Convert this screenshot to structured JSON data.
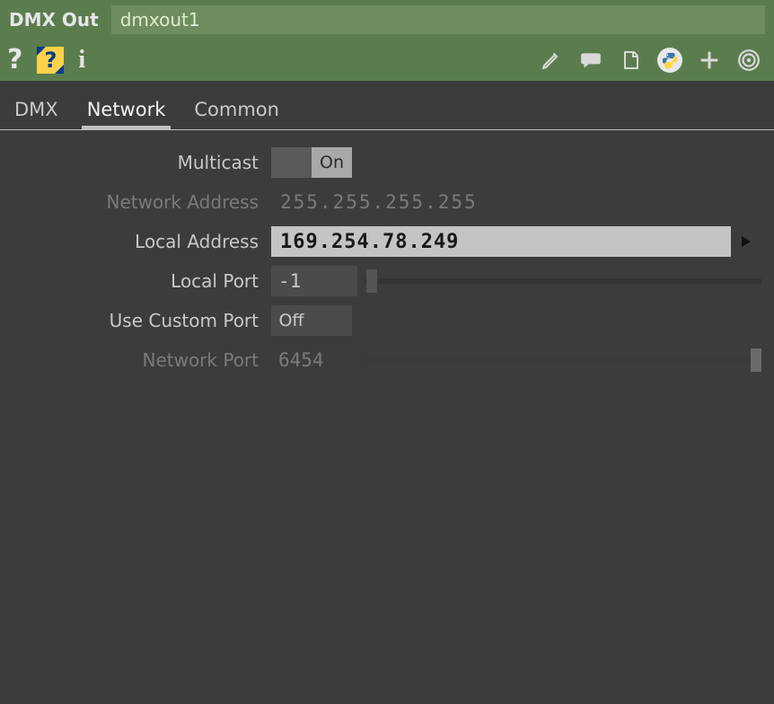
{
  "header": {
    "title": "DMX Out",
    "name": "dmxout1"
  },
  "tabs": [
    "DMX",
    "Network",
    "Common"
  ],
  "active_tab": "Network",
  "params": {
    "multicast": {
      "label": "Multicast",
      "state": "On"
    },
    "network_address": {
      "label": "Network Address",
      "value": "255.255.255.255"
    },
    "local_address": {
      "label": "Local Address",
      "value": "169.254.78.249"
    },
    "local_port": {
      "label": "Local Port",
      "value": "-1"
    },
    "use_custom_port": {
      "label": "Use Custom Port",
      "state": "Off"
    },
    "network_port": {
      "label": "Network Port",
      "value": "6454"
    }
  },
  "icons": {
    "help_q": "?",
    "help_box": "?",
    "info": "i"
  }
}
